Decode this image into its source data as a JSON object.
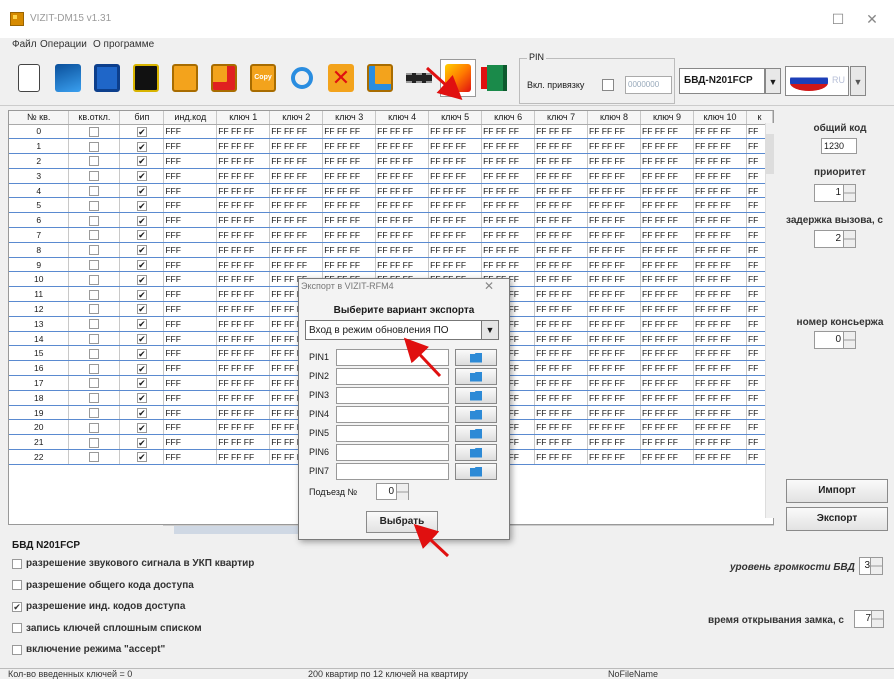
{
  "window": {
    "title": "VIZIT-DM15 v1.31"
  },
  "menu": [
    "Файл",
    "Операции",
    "О программе"
  ],
  "toolbar": {
    "icons": [
      "new-document-icon",
      "open-folder-icon",
      "save-icon",
      "code-calculator-icon",
      "key-icon",
      "add-key-icon",
      "copy-key-icon",
      "search-icon",
      "delete-icon",
      "key-edit-icon",
      "chip-icon",
      "export-arrow-icon",
      "exit-door-icon"
    ],
    "copy_text": "Copy",
    "pin": {
      "legend": "PIN",
      "label": "Вкл. привязку",
      "value": "0000000"
    },
    "model": "БВД-N201FCP",
    "lang": "RU"
  },
  "grid": {
    "headers": [
      "№ кв.",
      "кв.откл.",
      "бип",
      "инд.код",
      "ключ 1",
      "ключ 2",
      "ключ 3",
      "ключ 4",
      "ключ 5",
      "ключ 6",
      "ключ 7",
      "ключ 8",
      "ключ 9",
      "ключ 10",
      "к"
    ],
    "rows": [
      "0",
      "1",
      "2",
      "3",
      "4",
      "5",
      "6",
      "7",
      "8",
      "9",
      "10",
      "11",
      "12",
      "13",
      "14",
      "15",
      "16",
      "17",
      "18",
      "19",
      "20",
      "21",
      "22"
    ],
    "ind_code": "FFF",
    "key_value": "FF FF FF",
    "last_col_value": "FF",
    "beep_mark": "✔"
  },
  "right_panel": {
    "general_code_label": "общий код",
    "general_code_value": "1230",
    "priority_label": "приоритет",
    "priority_value": "1",
    "delay_label": "задержка вызова, с",
    "delay_value": "2",
    "concierge_label": "номер консьержа",
    "concierge_value": "0",
    "import_label": "Импорт",
    "export_label": "Экспорт"
  },
  "bdd": {
    "title": "БВД N201FCP",
    "options": [
      {
        "label": "разрешение звукового сигнала в УКП квартир",
        "checked": false
      },
      {
        "label": "разрешение общего кода доступа",
        "checked": false
      },
      {
        "label": "разрешение инд. кодов доступа",
        "checked": true
      },
      {
        "label": "запись ключей сплошным списком",
        "checked": false
      },
      {
        "label": "включение режима \"accept\"",
        "checked": false
      }
    ],
    "volume_label": "уровень громкости БВД",
    "volume_value": "3",
    "lock_label": "время открывания замка, с",
    "lock_value": "7",
    "check_mark": "✔"
  },
  "status": {
    "keys_count": "Кол-во введенных ключей = 0",
    "apartments": "200 квартир по 12 ключей на квартиру",
    "file": "NoFileName"
  },
  "dialog": {
    "title": "Экспорт в VIZIT-RFM4",
    "close": "✕",
    "header": "Выберите вариант экспорта",
    "option": "Вход в режим обновления ПО",
    "pins": [
      "PIN1",
      "PIN2",
      "PIN3",
      "PIN4",
      "PIN5",
      "PIN6",
      "PIN7"
    ],
    "entrance_label": "Подъезд №",
    "entrance_value": "0",
    "choose_button": "Выбрать"
  },
  "colors": {
    "annotation_arrow": "#e01010",
    "grid_row_line": "#5a8ad0",
    "accent_blue": "#2d8ad6"
  }
}
